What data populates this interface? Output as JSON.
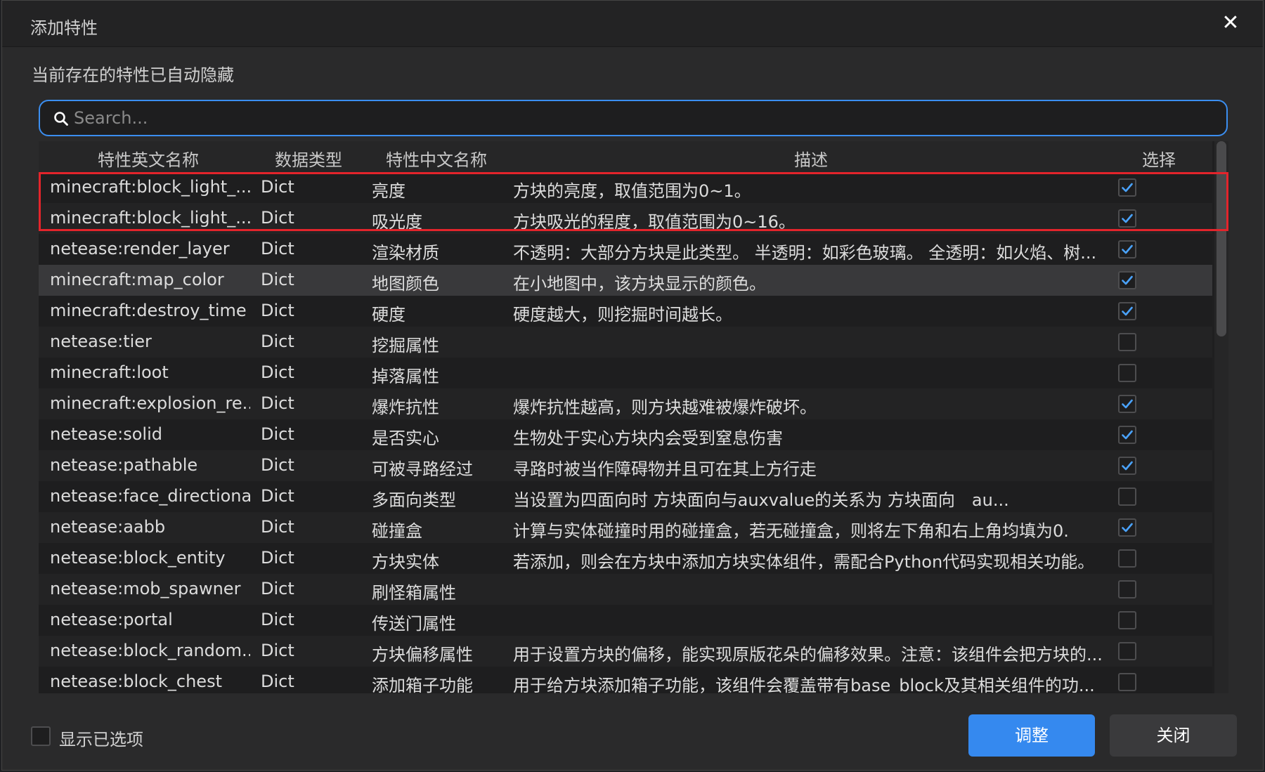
{
  "dialog": {
    "title": "添加特性",
    "hint": "当前存在的特性已自动隐藏"
  },
  "search": {
    "placeholder": "Search..."
  },
  "columns": [
    "特性英文名称",
    "数据类型",
    "特性中文名称",
    "描述",
    "选择"
  ],
  "rows": [
    {
      "en": "minecraft:block_light_...",
      "type": "Dict",
      "cn": "亮度",
      "desc": "方块的亮度，取值范围为0~1。",
      "checked": true
    },
    {
      "en": "minecraft:block_light_...",
      "type": "Dict",
      "cn": "吸光度",
      "desc": "方块吸光的程度，取值范围为0~16。",
      "checked": true
    },
    {
      "en": "netease:render_layer",
      "type": "Dict",
      "cn": "渲染材质",
      "desc": "不透明：大部分方块是此类型。 半透明：如彩色玻璃。 全透明：如火焰、树...",
      "checked": true
    },
    {
      "en": "minecraft:map_color",
      "type": "Dict",
      "cn": "地图颜色",
      "desc": "在小地图中，该方块显示的颜色。",
      "checked": true
    },
    {
      "en": "minecraft:destroy_time",
      "type": "Dict",
      "cn": "硬度",
      "desc": "硬度越大，则挖掘时间越长。",
      "checked": true
    },
    {
      "en": "netease:tier",
      "type": "Dict",
      "cn": "挖掘属性",
      "desc": "",
      "checked": false
    },
    {
      "en": "minecraft:loot",
      "type": "Dict",
      "cn": "掉落属性",
      "desc": "",
      "checked": false
    },
    {
      "en": "minecraft:explosion_re...",
      "type": "Dict",
      "cn": "爆炸抗性",
      "desc": "爆炸抗性越高，则方块越难被爆炸破坏。",
      "checked": true
    },
    {
      "en": "netease:solid",
      "type": "Dict",
      "cn": "是否实心",
      "desc": "生物处于实心方块内会受到窒息伤害",
      "checked": true
    },
    {
      "en": "netease:pathable",
      "type": "Dict",
      "cn": "可被寻路经过",
      "desc": "寻路时被当作障碍物并且可在其上方行走",
      "checked": true
    },
    {
      "en": "netease:face_directional",
      "type": "Dict",
      "cn": "多面向类型",
      "desc": "当设置为四面向时 方块面向与auxvalue的关系为 方块面向　au...",
      "checked": false
    },
    {
      "en": "netease:aabb",
      "type": "Dict",
      "cn": "碰撞盒",
      "desc": "计算与实体碰撞时用的碰撞盒，若无碰撞盒，则将左下角和右上角均填为0.",
      "checked": true
    },
    {
      "en": "netease:block_entity",
      "type": "Dict",
      "cn": "方块实体",
      "desc": "若添加，则会在方块中添加方块实体组件，需配合Python代码实现相关功能。",
      "checked": false
    },
    {
      "en": "netease:mob_spawner",
      "type": "Dict",
      "cn": "刷怪箱属性",
      "desc": "",
      "checked": false
    },
    {
      "en": "netease:portal",
      "type": "Dict",
      "cn": "传送门属性",
      "desc": "",
      "checked": false
    },
    {
      "en": "netease:block_random...",
      "type": "Dict",
      "cn": "方块偏移属性",
      "desc": "用于设置方块的偏移，能实现原版花朵的偏移效果。注意：该组件会把方块的...",
      "checked": false
    },
    {
      "en": "netease:block_chest",
      "type": "Dict",
      "cn": "添加箱子功能",
      "desc": "用于给方块添加箱子功能，该组件会覆盖带有base_block及其相关组件的功...",
      "checked": false
    }
  ],
  "hovered_row": 3,
  "footer": {
    "show_selected_label": "显示已选项",
    "adjust_label": "调整",
    "close_label": "关闭"
  },
  "colors": {
    "accent": "#3589ef",
    "check": "#4aa3ff",
    "highlight": "#e3242b"
  }
}
